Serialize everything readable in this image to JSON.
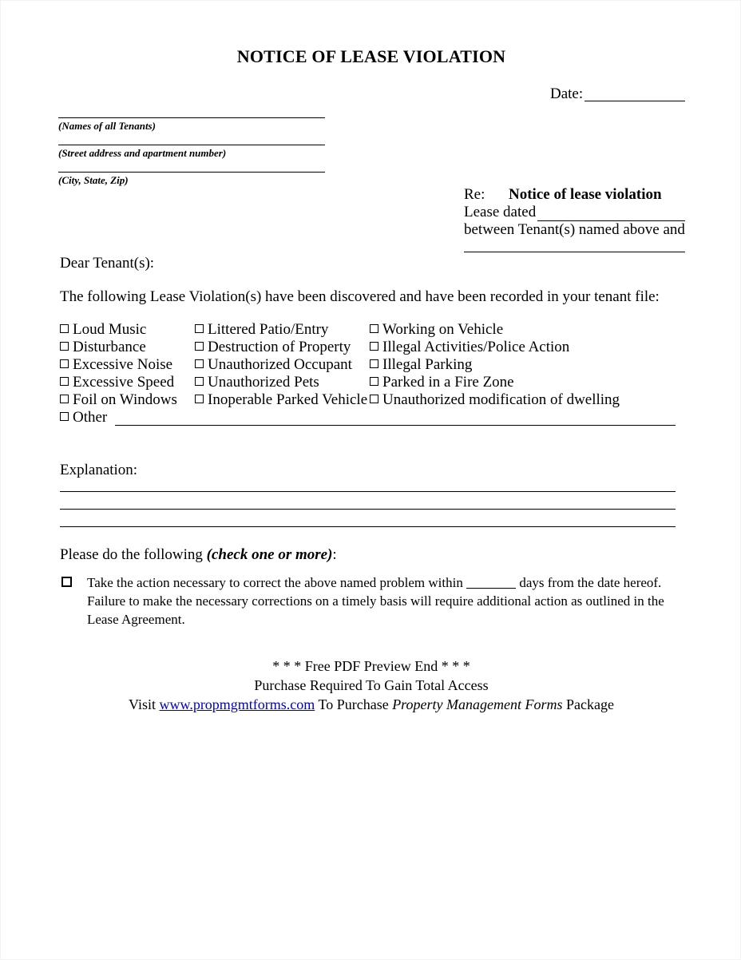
{
  "document": {
    "title": "NOTICE OF LEASE VIOLATION"
  },
  "date_field": {
    "label": "Date:"
  },
  "address_block": {
    "labels": [
      "(Names of all Tenants)",
      "(Street address and apartment number)",
      "(City, State, Zip)"
    ]
  },
  "re_block": {
    "re_label": "Re:",
    "re_value": "Notice of lease violation",
    "lease_dated_label": "Lease dated",
    "between_line": "between Tenant(s) named above and"
  },
  "body": {
    "salutation": "Dear Tenant(s):",
    "intro": "The following Lease Violation(s) have been discovered and have been recorded in your tenant file:"
  },
  "violations": {
    "rows": [
      {
        "col1": "Loud Music",
        "col2": "Littered Patio/Entry",
        "col3": "Working on Vehicle"
      },
      {
        "col1": "Disturbance",
        "col2": "Destruction of Property",
        "col3": "Illegal Activities/Police Action"
      },
      {
        "col1": "Excessive Noise",
        "col2": "Unauthorized Occupant",
        "col3": "Illegal Parking"
      },
      {
        "col1": "Excessive Speed",
        "col2": "Unauthorized Pets",
        "col3": "Parked in a Fire Zone"
      },
      {
        "col1": "Foil on Windows",
        "col2": "Inoperable Parked Vehicle",
        "col3": "Unauthorized modification of dwelling"
      }
    ],
    "other_label": "Other"
  },
  "explanation": {
    "label": "Explanation:"
  },
  "instructions": {
    "lead": "Please do the following ",
    "emphasis": "(check one or more)",
    "trailing": ":",
    "action_part1": "Take the action necessary to correct the above named problem within",
    "action_part2": "days from the date hereof.  Failure to make the necessary corrections on a timely basis will require additional action as outlined in the Lease Agreement."
  },
  "footer": {
    "line1": "* * * Free PDF Preview End * * *",
    "line2": "Purchase Required To Gain Total Access",
    "line3_prefix": "Visit ",
    "link": "www.propmgmtforms.com",
    "line3_middle": " To Purchase ",
    "line3_emphasis": "Property Management Forms",
    "line3_suffix": " Package"
  },
  "colors": {
    "text": "#000000",
    "link": "#0000cc",
    "page_background": "#ffffff"
  }
}
